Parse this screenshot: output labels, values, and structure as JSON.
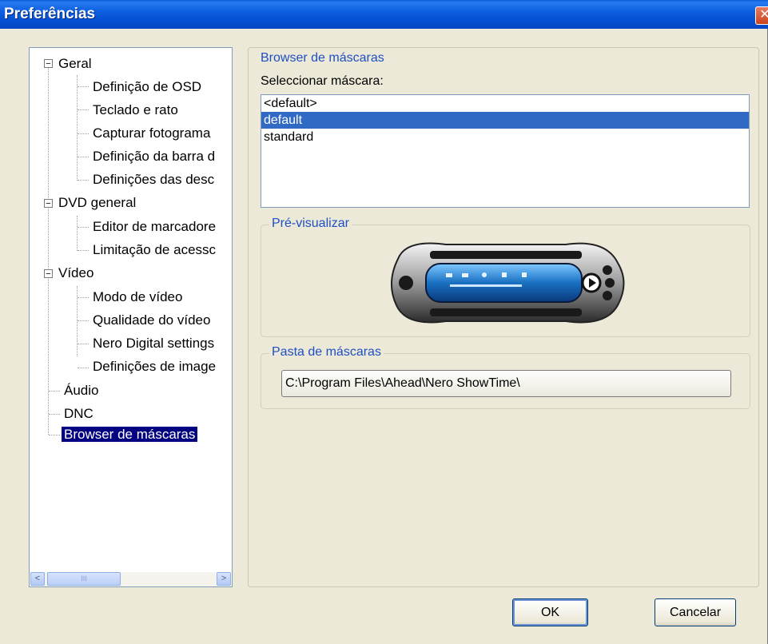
{
  "window": {
    "title": "Preferências",
    "close_glyph": "✕"
  },
  "tree": {
    "items": [
      {
        "label": "Geral",
        "level": 0,
        "toggle": "−"
      },
      {
        "label": "Definição de OSD",
        "level": 1
      },
      {
        "label": "Teclado e rato",
        "level": 1
      },
      {
        "label": "Capturar fotograma",
        "level": 1
      },
      {
        "label": "Definição da barra d",
        "level": 1
      },
      {
        "label": "Definições das desc",
        "level": 1
      },
      {
        "label": "DVD general",
        "level": 0,
        "toggle": "−"
      },
      {
        "label": "Editor de marcadore",
        "level": 1
      },
      {
        "label": "Limitação de acessc",
        "level": 1
      },
      {
        "label": "Vídeo",
        "level": 0,
        "toggle": "−"
      },
      {
        "label": "Modo de vídeo",
        "level": 1
      },
      {
        "label": "Qualidade do vídeo",
        "level": 1
      },
      {
        "label": "Nero Digital settings",
        "level": 1
      },
      {
        "label": "Definições de image",
        "level": 1
      },
      {
        "label": "Áudio",
        "level": 0
      },
      {
        "label": "DNC",
        "level": 0
      },
      {
        "label": "Browser de máscaras",
        "level": 0,
        "selected": true
      }
    ],
    "scroll_left": "<",
    "scroll_right": ">",
    "scroll_thumb_grip": "III"
  },
  "skins": {
    "group_title": "Browser de máscaras",
    "select_label": "Seleccionar máscara:",
    "list": [
      "<default>",
      "default",
      "standard"
    ],
    "selected_index": 1
  },
  "preview": {
    "group_title": "Pré-visualizar",
    "image_icon": "media-player-skin-preview-image"
  },
  "folder": {
    "group_title": "Pasta de máscaras",
    "path": "C:\\Program Files\\Ahead\\Nero ShowTime\\"
  },
  "buttons": {
    "ok": "OK",
    "cancel": "Cancelar"
  },
  "colors": {
    "title_bar": "#0b5fe0",
    "selection": "#316ac5",
    "group_title": "#1e4fc2",
    "tree_selection": "#000080"
  }
}
